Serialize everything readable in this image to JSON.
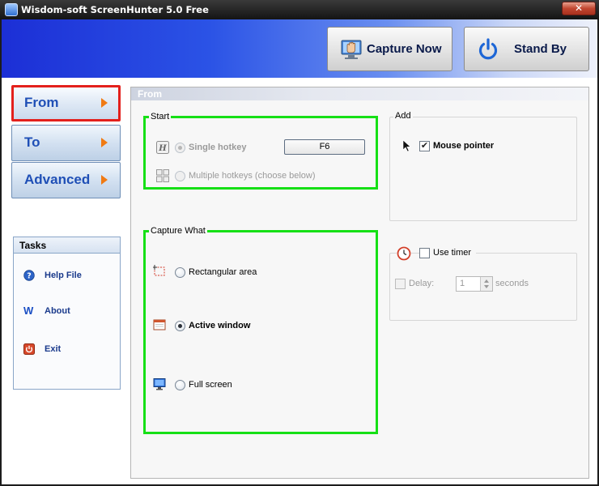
{
  "window": {
    "title": "Wisdom-soft ScreenHunter 5.0 Free",
    "close_glyph": "✕"
  },
  "toolbar": {
    "capture_now": "Capture Now",
    "stand_by": "Stand By"
  },
  "nav": {
    "items": [
      {
        "label": "From",
        "selected": true
      },
      {
        "label": "To",
        "selected": false
      },
      {
        "label": "Advanced",
        "selected": false
      }
    ]
  },
  "tasks": {
    "title": "Tasks",
    "items": [
      {
        "label": "Help File",
        "icon": "help-icon"
      },
      {
        "label": "About",
        "icon": "about-icon",
        "glyph": "W"
      },
      {
        "label": "Exit",
        "icon": "exit-icon"
      }
    ]
  },
  "panel": {
    "title": "From",
    "start": {
      "title": "Start",
      "single_hotkey": "Single hotkey",
      "hotkey_value": "F6",
      "multiple_hotkeys": "Multiple hotkeys  (choose below)",
      "hotkey_glyph": "H"
    },
    "add": {
      "title": "Add",
      "mouse_pointer": "Mouse pointer",
      "mouse_pointer_checked": true
    },
    "capture_what": {
      "title": "Capture What",
      "options": [
        {
          "label": "Rectangular area",
          "checked": false
        },
        {
          "label": "Active window",
          "checked": true
        },
        {
          "label": "Full screen",
          "checked": false
        }
      ]
    },
    "timer": {
      "use_timer": "Use timer",
      "delay": "Delay:",
      "delay_value": "1",
      "seconds": "seconds"
    }
  },
  "colors": {
    "highlight_green": "#16e016",
    "selected_red": "#e3201c",
    "nav_text_blue": "#1f4fb6",
    "arrow_orange": "#f07a13"
  }
}
